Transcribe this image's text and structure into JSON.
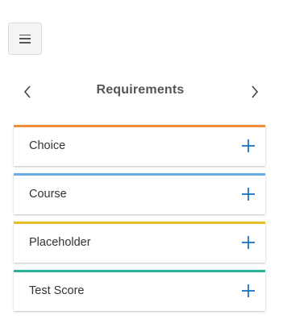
{
  "menu": {
    "icon": "hamburger-icon"
  },
  "nav": {
    "title": "Requirements",
    "prev_icon": "chevron-left-icon",
    "next_icon": "chevron-right-icon"
  },
  "requirements": [
    {
      "label": "Choice",
      "color": "#f28c38",
      "action_icon": "plus-icon"
    },
    {
      "label": "Course",
      "color": "#6aace6",
      "action_icon": "plus-icon"
    },
    {
      "label": "Placeholder",
      "color": "#e8c12a",
      "action_icon": "plus-icon"
    },
    {
      "label": "Test Score",
      "color": "#2bb39a",
      "action_icon": "plus-icon"
    }
  ],
  "colors": {
    "plus": "#1a73c9",
    "chevron": "#444444"
  }
}
